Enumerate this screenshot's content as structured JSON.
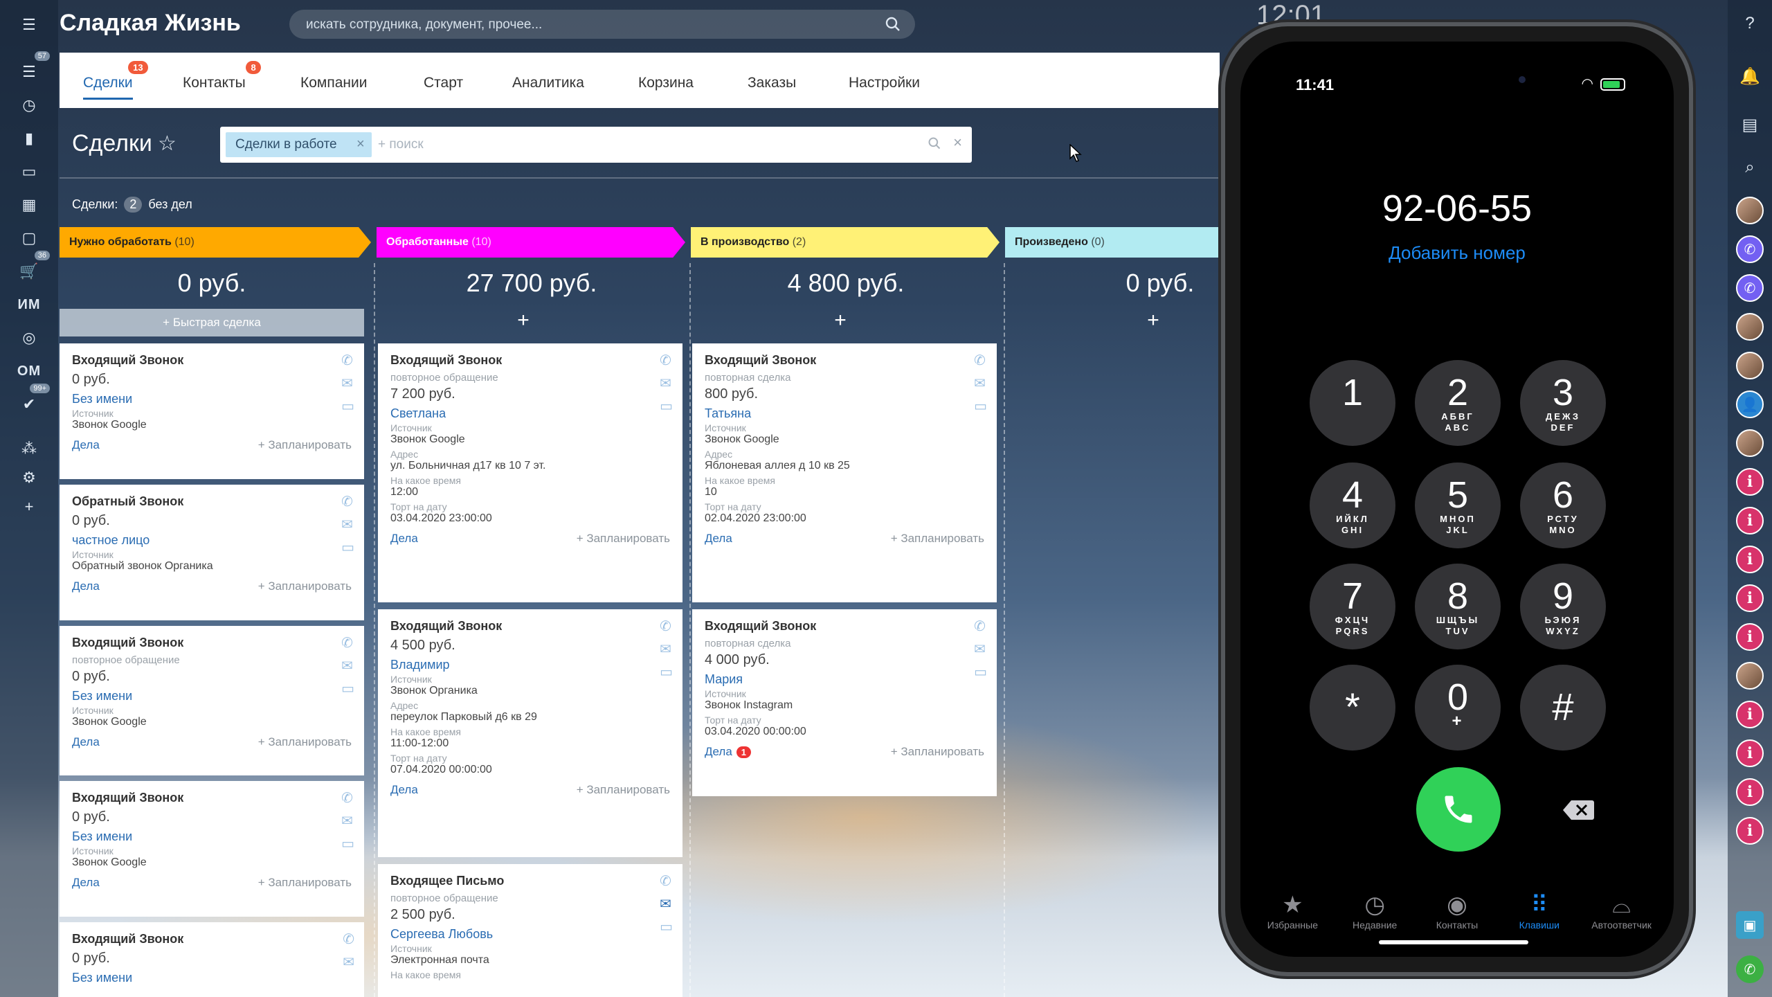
{
  "app": {
    "title": "Сладкая Жизнь",
    "search_placeholder": "искать сотрудника, документ, прочее...",
    "clock_partial": "12:01"
  },
  "left_rail": {
    "badges": {
      "filter": "57",
      "cart": "36",
      "check": "99+"
    },
    "labels": {
      "im": "ИМ",
      "om": "ОМ"
    }
  },
  "tabs": [
    {
      "label": "Сделки",
      "badge": "13"
    },
    {
      "label": "Контакты",
      "badge": "8"
    },
    {
      "label": "Компании"
    },
    {
      "label": "Старт"
    },
    {
      "label": "Аналитика"
    },
    {
      "label": "Корзина"
    },
    {
      "label": "Заказы"
    },
    {
      "label": "Настройки"
    }
  ],
  "page": {
    "title": "Сделки",
    "filter_chip": "Сделки в работе",
    "filter_placeholder": "+ поиск",
    "summary_prefix": "Сделки:",
    "summary_count": "2",
    "summary_suffix": "без дел",
    "quick_deal": "+ Быстрая сделка"
  },
  "stages": [
    {
      "name": "Нужно обработать",
      "count": "(10)",
      "sum": "0 руб.",
      "color": "#ffa900"
    },
    {
      "name": "Обработанные",
      "count": "(10)",
      "sum": "27 700 руб.",
      "color": "#ff00ff"
    },
    {
      "name": "В производство",
      "count": "(2)",
      "sum": "4 800 руб.",
      "color": "#fff176"
    },
    {
      "name": "Произведено",
      "count": "(0)",
      "sum": "0 руб.",
      "color": "#b2ebf2"
    }
  ],
  "col1": [
    {
      "title": "Входящий Звонок",
      "price": "0 руб.",
      "contact": "Без имени",
      "src_label": "Источник",
      "src": "Звонок Google",
      "deals": "Дела",
      "plan": "+ Запланировать"
    },
    {
      "title": "Обратный Звонок",
      "price": "0 руб.",
      "contact": "частное лицо",
      "src_label": "Источник",
      "src": "Обратный звонок Органика",
      "deals": "Дела",
      "plan": "+ Запланировать"
    },
    {
      "title": "Входящий Звонок",
      "sub": "повторное обращение",
      "price": "0 руб.",
      "contact": "Без имени",
      "src_label": "Источник",
      "src": "Звонок Google",
      "deals": "Дела",
      "plan": "+ Запланировать"
    },
    {
      "title": "Входящий Звонок",
      "price": "0 руб.",
      "contact": "Без имени",
      "src_label": "Источник",
      "src": "Звонок Google",
      "deals": "Дела",
      "plan": "+ Запланировать"
    },
    {
      "title": "Входящий Звонок",
      "price": "0 руб.",
      "contact": "Без имени"
    }
  ],
  "col2": [
    {
      "title": "Входящий Звонок",
      "sub": "повторное обращение",
      "price": "7 200 руб.",
      "contact": "Светлана",
      "src_label": "Источник",
      "src": "Звонок Google",
      "addr_label": "Адрес",
      "addr": "ул. Больничная д17 кв 10 7 эт.",
      "time_label": "На какое время",
      "time": "12:00",
      "date_label": "Торт на дату",
      "date": "03.04.2020 23:00:00",
      "deals": "Дела",
      "plan": "+ Запланировать"
    },
    {
      "title": "Входящий Звонок",
      "price": "4 500 руб.",
      "contact": "Владимир",
      "src_label": "Источник",
      "src": "Звонок Органика",
      "addr_label": "Адрес",
      "addr": "переулок Парковый д6 кв 29",
      "time_label": "На какое время",
      "time": "11:00-12:00",
      "date_label": "Торт на дату",
      "date": "07.04.2020 00:00:00",
      "deals": "Дела",
      "plan": "+ Запланировать"
    },
    {
      "title": "Входящее Письмо",
      "sub": "повторное обращение",
      "price": "2 500 руб.",
      "contact": "Сергеева Любовь",
      "src_label": "Источник",
      "src": "Электронная почта",
      "time_label": "На какое время"
    }
  ],
  "col3": [
    {
      "title": "Входящий Звонок",
      "sub": "повторная сделка",
      "price": "800 руб.",
      "contact": "Татьяна",
      "src_label": "Источник",
      "src": "Звонок Google",
      "addr_label": "Адрес",
      "addr": "Яблоневая аллея д 10 кв 25",
      "time_label": "На какое время",
      "time": "10",
      "date_label": "Торт на дату",
      "date": "02.04.2020 23:00:00",
      "deals": "Дела",
      "plan": "+ Запланировать"
    },
    {
      "title": "Входящий Звонок",
      "sub": "повторная сделка",
      "price": "4 000 руб.",
      "contact": "Мария",
      "src_label": "Источник",
      "src": "Звонок Instagram",
      "date_label": "Торт на дату",
      "date": "03.04.2020 00:00:00",
      "deals": "Дела",
      "deals_badge": "1",
      "plan": "+ Запланировать"
    }
  ],
  "phone": {
    "time": "11:41",
    "number": "92-06-55",
    "add_number": "Добавить номер",
    "keys": [
      {
        "d": "1",
        "l": ""
      },
      {
        "d": "2",
        "l": "АБВГ\nABC"
      },
      {
        "d": "3",
        "l": "ДЕЖЗ\nDEF"
      },
      {
        "d": "4",
        "l": "ИЙКЛ\nGHI"
      },
      {
        "d": "5",
        "l": "МНОП\nJKL"
      },
      {
        "d": "6",
        "l": "РСТУ\nMNO"
      },
      {
        "d": "7",
        "l": "ФХЦЧ\nPQRS"
      },
      {
        "d": "8",
        "l": "ШЩЪЫ\nTUV"
      },
      {
        "d": "9",
        "l": "ЬЭЮЯ\nWXYZ"
      },
      {
        "d": "*",
        "l": ""
      },
      {
        "d": "0",
        "l": "+"
      },
      {
        "d": "#",
        "l": ""
      }
    ],
    "tabs": [
      "Избранные",
      "Недавние",
      "Контакты",
      "Клавиши",
      "Автоответчик"
    ],
    "active_tab": "Клавиши"
  },
  "colors": {
    "accent": "#2067b0",
    "call_green": "#30d158",
    "ios_blue": "#1d8cf7",
    "badge_red": "#f15a3a"
  }
}
